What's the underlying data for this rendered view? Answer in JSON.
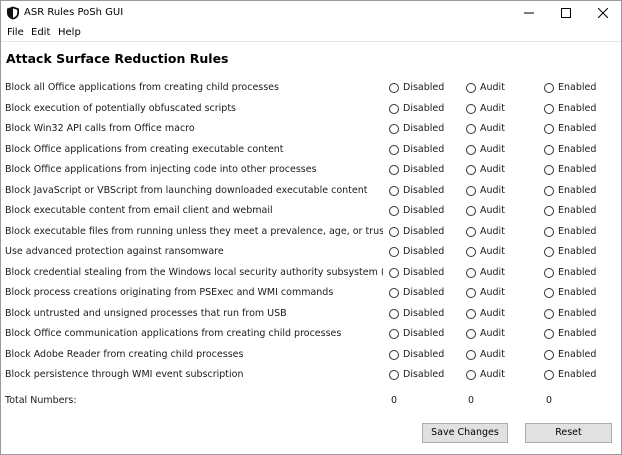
{
  "window": {
    "title": "ASR Rules PoSh GUI"
  },
  "menu": {
    "file": "File",
    "edit": "Edit",
    "help": "Help"
  },
  "page": {
    "heading": "Attack Surface Reduction Rules"
  },
  "options": {
    "disabled": "Disabled",
    "audit": "Audit",
    "enabled": "Enabled"
  },
  "rules": [
    "Block all Office applications from creating child processes",
    "Block execution of potentially obfuscated scripts",
    "Block Win32 API calls from Office macro",
    "Block Office applications from creating executable content",
    "Block Office applications from injecting code into other processes",
    "Block JavaScript or VBScript from launching downloaded executable content",
    "Block executable content from email client and webmail",
    "Block executable files from running unless they meet a prevalence, age, or trusted list criter",
    "Use advanced protection against ransomware",
    "Block credential stealing from the Windows local security authority subsystem (lsass.exe)",
    "Block process creations originating from PSExec and WMI commands",
    "Block untrusted and unsigned processes that run from USB",
    "Block Office communication applications from creating child processes",
    "Block Adobe Reader from creating child processes",
    "Block persistence through WMI event subscription"
  ],
  "totals": {
    "label": "Total Numbers:",
    "disabled": "0",
    "audit": "0",
    "enabled": "0"
  },
  "buttons": {
    "save": "Save Changes",
    "reset": "Reset"
  },
  "icons": {
    "app": "shield-icon",
    "minimize": "minimize-icon",
    "maximize": "maximize-icon",
    "close": "close-icon"
  },
  "colors": {
    "background": "#ffffff",
    "button_face": "#e1e1e1",
    "button_border": "#adadad"
  }
}
